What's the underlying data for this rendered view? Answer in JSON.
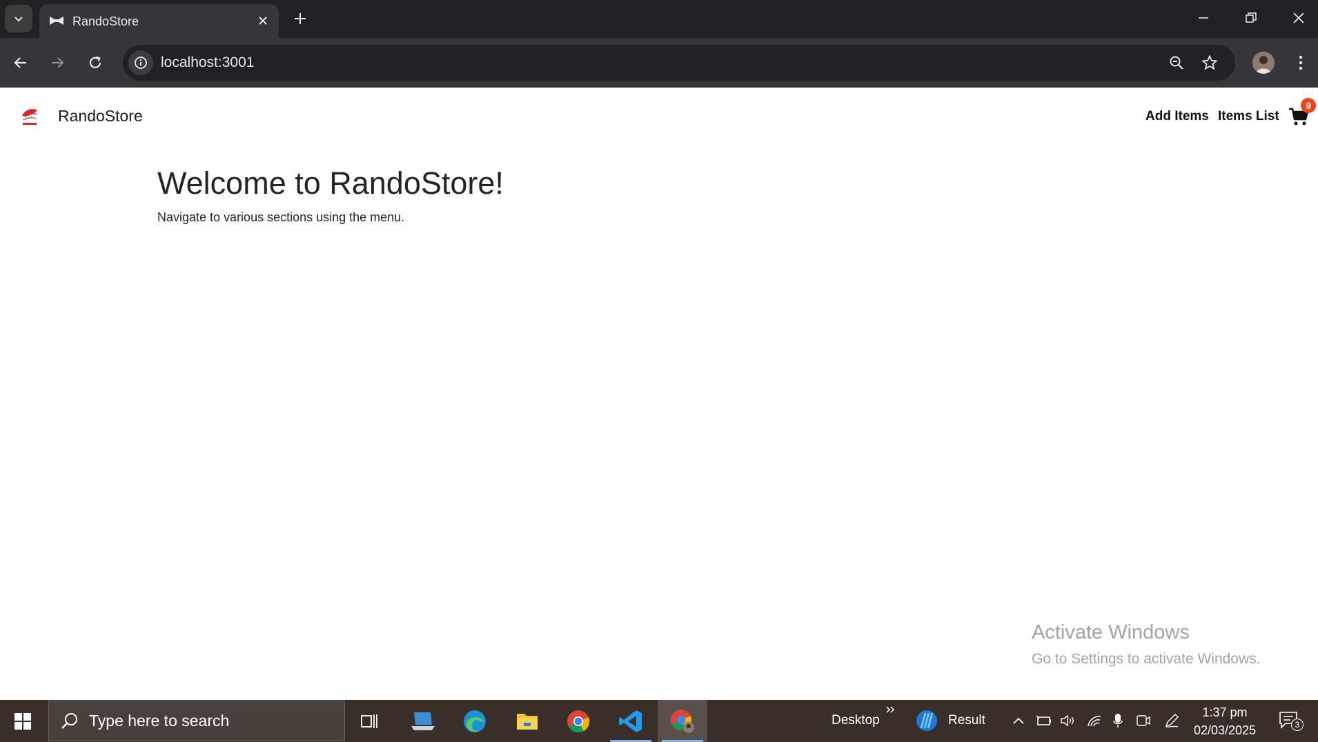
{
  "browser": {
    "tab_title": "RandoStore",
    "url": "localhost:3001"
  },
  "site": {
    "brand_name": "RandoStore",
    "nav": {
      "add_items": "Add Items",
      "items_list": "Items List"
    },
    "cart_count": "9",
    "welcome_title": "Welcome to RandoStore!",
    "welcome_subtitle": "Navigate to various sections using the menu."
  },
  "watermark": {
    "title": "Activate Windows",
    "subtitle": "Go to Settings to activate Windows."
  },
  "taskbar": {
    "search_placeholder": "Type here to search",
    "desktop_label": "Desktop",
    "result_label": "Result",
    "time": "1:37 pm",
    "date": "02/03/2025",
    "notification_count": "3"
  },
  "colors": {
    "chrome_dark": "#202124",
    "chrome_toolbar": "#35363a",
    "cart_badge": "#f0441a",
    "taskbar": "#3a2e29"
  }
}
